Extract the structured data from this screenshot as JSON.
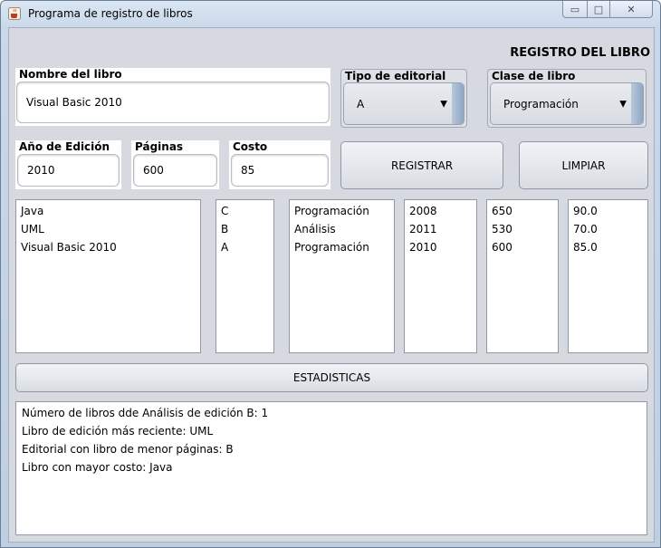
{
  "window": {
    "title": "Programa de registro de libros",
    "controls": {
      "minimize": "▭",
      "maximize": "□",
      "close": "✕"
    }
  },
  "form": {
    "heading": "REGISTRO DEL LIBRO",
    "book_name": {
      "label": "Nombre del libro",
      "value": "Visual Basic 2010"
    },
    "publisher_type": {
      "label": "Tipo de editorial",
      "value": "A"
    },
    "book_class": {
      "label": "Clase de libro",
      "value": "Programación"
    },
    "edition_year": {
      "label": "Año de Edición",
      "value": "2010"
    },
    "pages": {
      "label": "Páginas",
      "value": "600"
    },
    "cost": {
      "label": "Costo",
      "value": "85"
    },
    "register_button": "REGISTRAR",
    "clear_button": "LIMPIAR"
  },
  "lists": {
    "names": [
      "Java",
      "UML",
      "Visual Basic 2010"
    ],
    "publishers": [
      "C",
      "B",
      "A"
    ],
    "classes": [
      "Programación",
      "Análisis",
      "Programación"
    ],
    "years": [
      "2008",
      "2011",
      "2010"
    ],
    "pages": [
      "650",
      "530",
      "600"
    ],
    "costs": [
      "90.0",
      "70.0",
      "85.0"
    ]
  },
  "stats_button": "ESTADISTICAS",
  "stats": [
    "Número de libros dde Análisis de edición B: 1",
    "Libro de edición más reciente: UML",
    "Editorial con libro de menor páginas: B",
    "Libro con mayor costo: Java"
  ],
  "icons": {
    "app": "java-cup-icon",
    "dropdown": "chevron-down-icon"
  }
}
